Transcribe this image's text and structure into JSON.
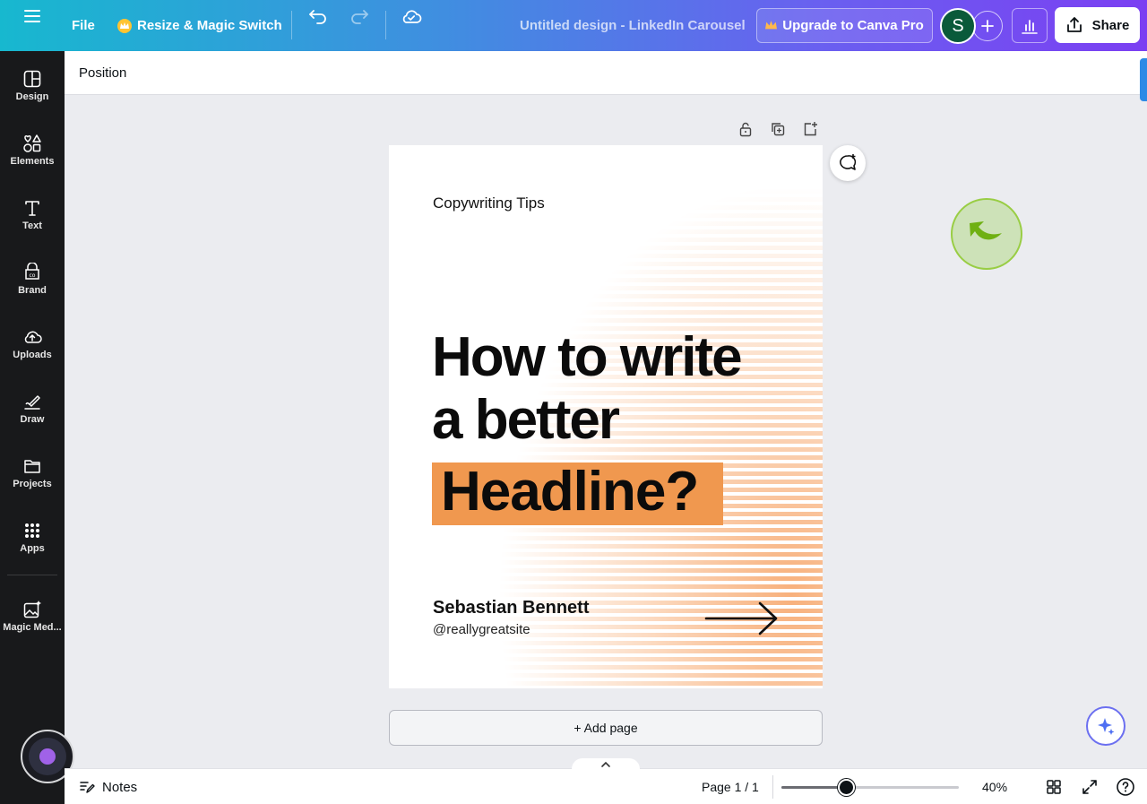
{
  "topbar": {
    "menu_icon": "hamburger-icon",
    "file_label": "File",
    "magic_switch_label": "Resize & Magic Switch",
    "doc_title": "Untitled design - LinkedIn Carousel",
    "upgrade_label": "Upgrade to Canva Pro",
    "avatar_initial": "S",
    "share_label": "Share"
  },
  "sidebar": {
    "items": [
      {
        "label": "Design",
        "icon": "design-icon"
      },
      {
        "label": "Elements",
        "icon": "elements-icon"
      },
      {
        "label": "Text",
        "icon": "text-icon"
      },
      {
        "label": "Brand",
        "icon": "brand-icon"
      },
      {
        "label": "Uploads",
        "icon": "uploads-icon"
      },
      {
        "label": "Draw",
        "icon": "draw-icon"
      },
      {
        "label": "Projects",
        "icon": "folder-icon"
      },
      {
        "label": "Apps",
        "icon": "apps-icon"
      },
      {
        "label": "Magic Med...",
        "icon": "magic-media-icon"
      }
    ]
  },
  "context_toolbar": {
    "position_label": "Position"
  },
  "design": {
    "kicker": "Copywriting Tips",
    "headline_line1": "How to write",
    "headline_line2": "a better",
    "headline_highlight": "Headline?",
    "author": "Sebastian Bennett",
    "handle": "@reallygreatsite",
    "highlight_color": "#f0984f"
  },
  "canvas": {
    "add_page_label": "+ Add page"
  },
  "bottombar": {
    "notes_label": "Notes",
    "page_indicator": "Page 1 / 1",
    "zoom_value": "40%",
    "zoom_fraction": 0.37
  },
  "colors": {
    "accent_gradient_start": "#17b8cf",
    "accent_gradient_end": "#7b3ff2",
    "sidebar_bg": "#18191b"
  }
}
